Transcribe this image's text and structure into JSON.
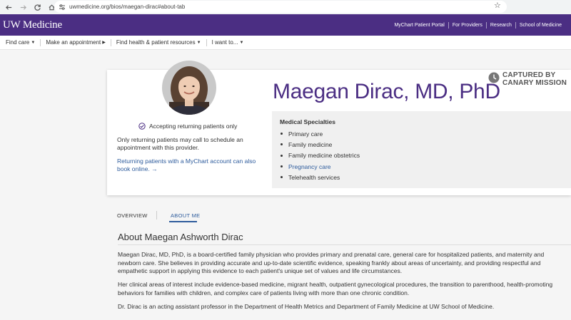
{
  "browser": {
    "url": "uwmedicine.org/bios/maegan-dirac#about-tab"
  },
  "header": {
    "logo": "UW Medicine",
    "links": [
      "MyChart Patient Portal",
      "For Providers",
      "Research",
      "School of Medicine"
    ]
  },
  "subnav": {
    "items": [
      "Find care",
      "Make an appointment",
      "Find health & patient resources",
      "I want to..."
    ]
  },
  "profile": {
    "name": "Maegan Dirac, MD, PhD",
    "accepting": "Accepting returning patients only",
    "returning_note": "Only returning patients may call to schedule an appointment with this provider.",
    "mychart_link": "Returning patients with a MyChart account can also book online.",
    "captured_line1": "CAPTURED BY",
    "captured_line2": "CANARY MISSION",
    "specialties_title": "Medical Specialties",
    "specialties": [
      "Primary care",
      "Family medicine",
      "Family medicine obstetrics",
      "Pregnancy care",
      "Telehealth services"
    ]
  },
  "tabs": {
    "overview": "OVERVIEW",
    "about": "ABOUT ME"
  },
  "about": {
    "title": "About Maegan Ashworth Dirac",
    "p1": "Maegan Dirac, MD, PhD, is a board-certified family physician who provides primary and prenatal care, general care for hospitalized patients, and maternity and newborn care. She believes in providing accurate and up-to-date scientific evidence, speaking frankly about areas of uncertainty, and providing respectful and empathetic support in applying this evidence to each patient's unique set of values and life circumstances.",
    "p2": "Her clinical areas of interest include evidence-based medicine, migrant health, outpatient gynecological procedures, the transition to parenthood, health-promoting behaviors for families with children, and complex care of patients living with more than one chronic condition.",
    "p3": "Dr. Dirac is an acting assistant professor in the Department of Health Metrics and Department of Family Medicine at UW School of Medicine."
  },
  "colors": {
    "brand_purple": "#4b2e83",
    "link_blue": "#2d5b9c"
  }
}
